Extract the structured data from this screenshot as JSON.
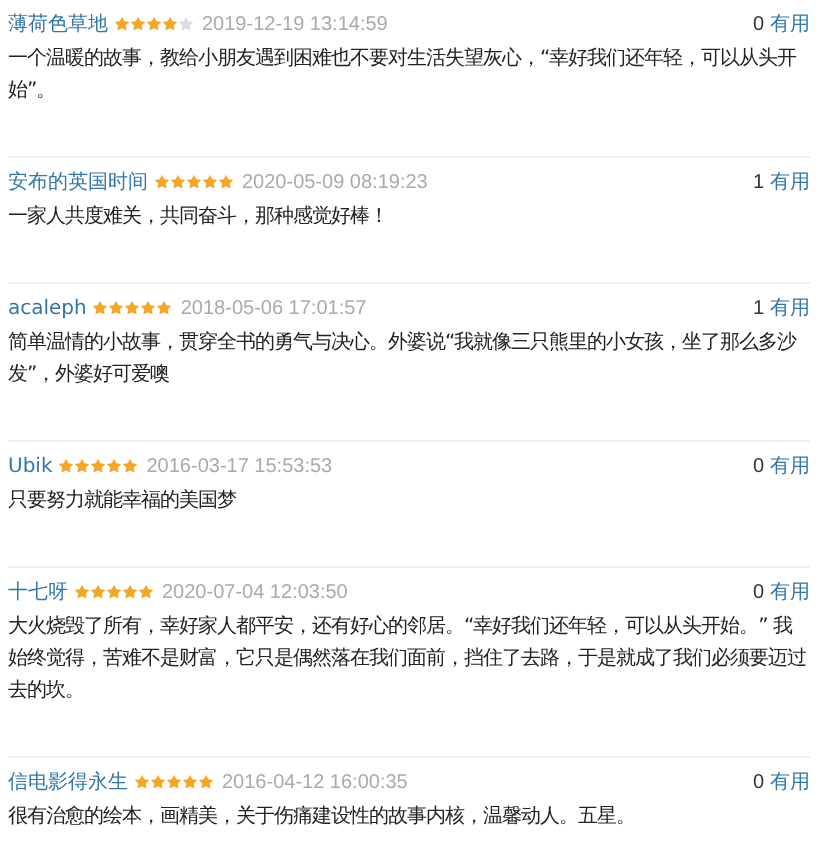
{
  "reviews": [
    {
      "author": "薄荷色草地",
      "stars": 4,
      "date": "2019-12-19 13:14:59",
      "votes": "0",
      "vote_label": "有用",
      "text": "一个温暖的故事，教给小朋友遇到困难也不要对生活失望灰心，“幸好我们还年轻，可以从头开始”。"
    },
    {
      "author": "安布的英国时间",
      "stars": 5,
      "date": "2020-05-09 08:19:23",
      "votes": "1",
      "vote_label": "有用",
      "text": "一家人共度难关，共同奋斗，那种感觉好棒！"
    },
    {
      "author": "acaleph",
      "stars": 5,
      "date": "2018-05-06 17:01:57",
      "votes": "1",
      "vote_label": "有用",
      "text": "简单温情的小故事，贯穿全书的勇气与决心。外婆说“我就像三只熊里的小女孩，坐了那么多沙发”，外婆好可爱噢"
    },
    {
      "author": "Ubik",
      "stars": 5,
      "date": "2016-03-17 15:53:53",
      "votes": "0",
      "vote_label": "有用",
      "text": "只要努力就能幸福的美国梦"
    },
    {
      "author": "十七呀",
      "stars": 5,
      "date": "2020-07-04 12:03:50",
      "votes": "0",
      "vote_label": "有用",
      "text": "大火烧毁了所有，幸好家人都平安，还有好心的邻居。“幸好我们还年轻，可以从头开始。” 我始终觉得，苦难不是财富，它只是偶然落在我们面前，挡住了去路，于是就成了我们必须要迈过去的坎。"
    },
    {
      "author": "信电影得永生",
      "stars": 5,
      "date": "2016-04-12 16:00:35",
      "votes": "0",
      "vote_label": "有用",
      "text": "很有治愈的绘本，画精美，关于伤痛建设性的故事内核，温馨动人。五星。"
    }
  ]
}
